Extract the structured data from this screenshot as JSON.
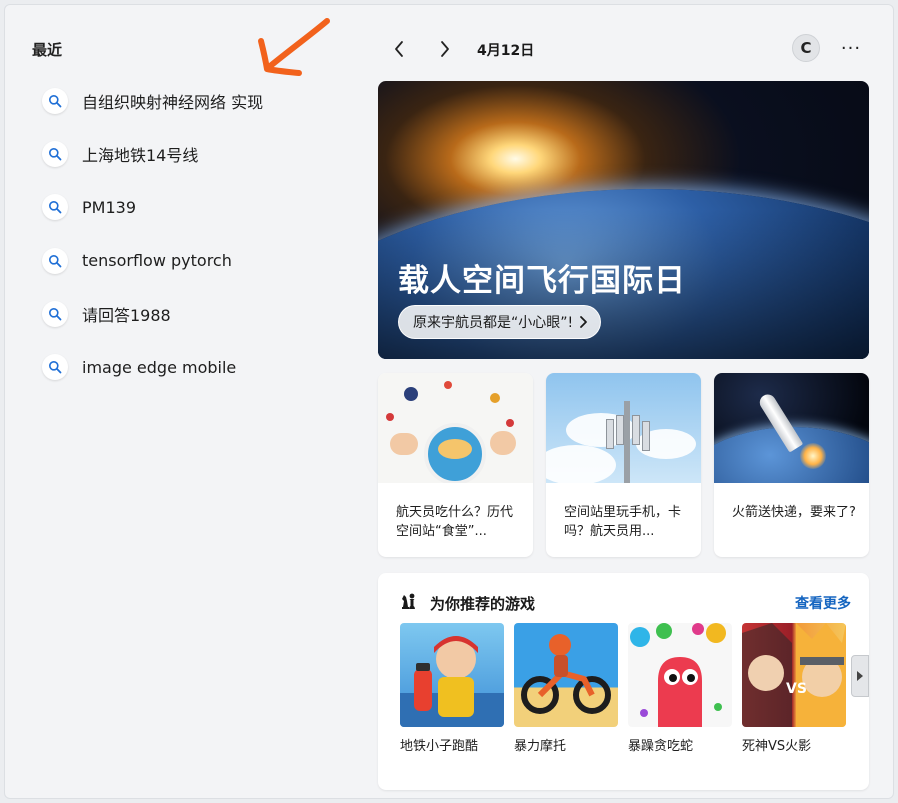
{
  "recent": {
    "title": "最近",
    "items": [
      {
        "label": "自组织映射神经网络 实现"
      },
      {
        "label": "上海地铁14号线"
      },
      {
        "label": "PM139"
      },
      {
        "label": "tensorflow pytorch"
      },
      {
        "label": "请回答1988"
      },
      {
        "label": "image edge mobile"
      }
    ]
  },
  "header": {
    "date": "4月12日",
    "avatar_letter": "C",
    "more": "···"
  },
  "hero": {
    "title": "载人空间飞行国际日",
    "subtitle": "原来宇航员都是“小心眼”!"
  },
  "news": [
    {
      "text": "航天员吃什么？历代空间站“食堂”..."
    },
    {
      "text": "空间站里玩手机，卡吗？航天员用..."
    },
    {
      "text": "火箭送快递，要来了?"
    }
  ],
  "games": {
    "title": "为你推荐的游戏",
    "see_more": "查看更多",
    "items": [
      {
        "name": "地铁小子跑酷"
      },
      {
        "name": "暴力摩托"
      },
      {
        "name": "暴躁贪吃蛇"
      },
      {
        "name": "死神VS火影"
      }
    ]
  },
  "colors": {
    "accent": "#1565c0",
    "annotation": "#f2621c",
    "search_icon": "#1f6fd6"
  }
}
